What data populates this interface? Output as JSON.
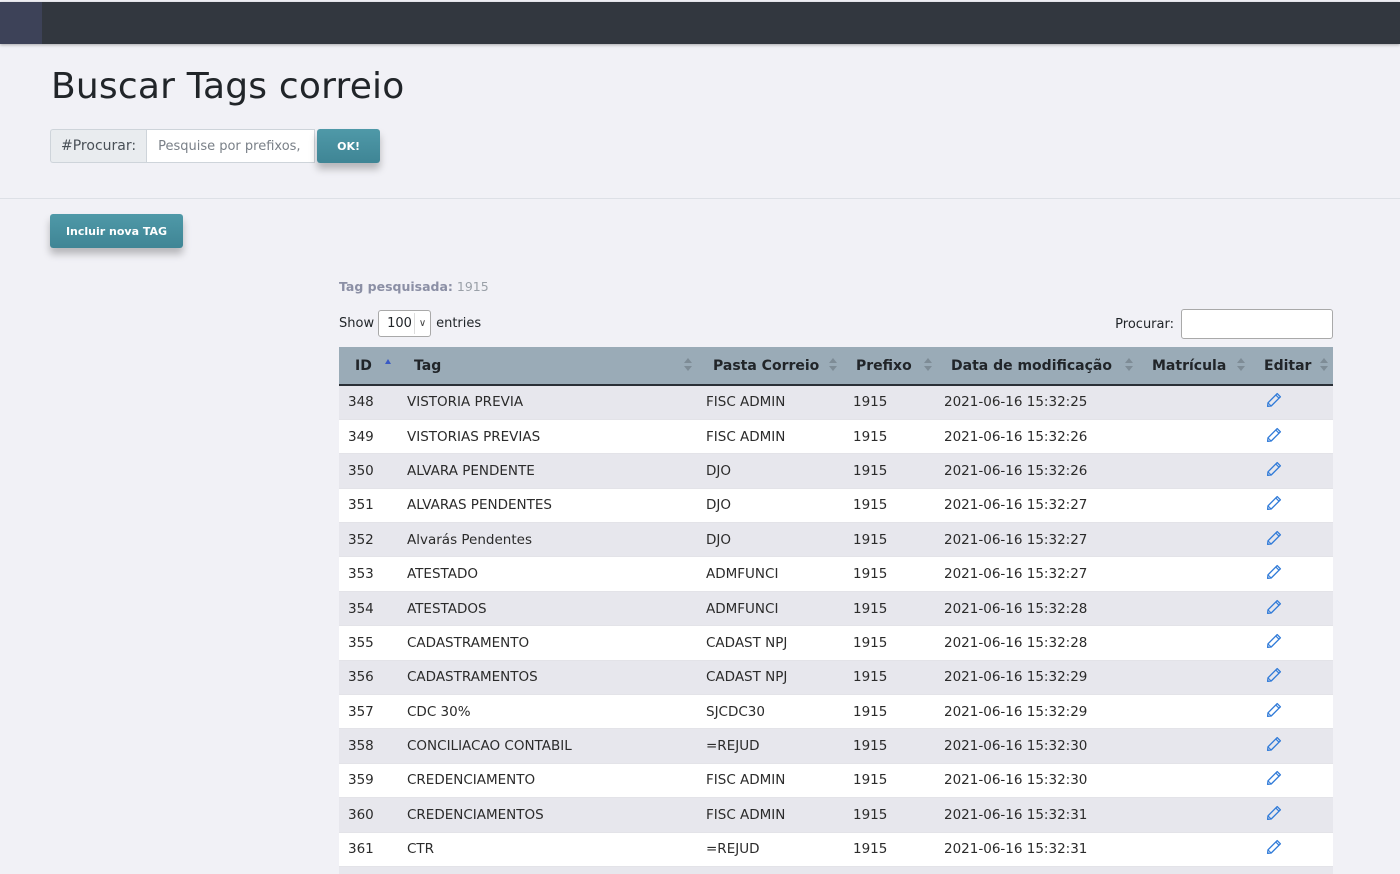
{
  "page": {
    "title": "Buscar Tags correio"
  },
  "search": {
    "prefix_label": "#Procurar:",
    "placeholder": "Pesquise por prefixos, tags...",
    "ok_label": "OK!"
  },
  "actions": {
    "new_tag_label": "Incluir nova TAG"
  },
  "result_info": {
    "label": "Tag pesquisada:",
    "value": "1915"
  },
  "table_controls": {
    "show_label": "Show",
    "entries_value": "100",
    "entries_label": "entries",
    "filter_label": "Procurar:"
  },
  "table": {
    "columns": [
      "ID",
      "Tag",
      "Pasta Correio",
      "Prefixo",
      "Data de modificação",
      "Matrícula",
      "Editar"
    ],
    "rows": [
      {
        "id": "348",
        "tag": "VISTORIA PREVIA",
        "pasta": "FISC ADMIN",
        "prefixo": "1915",
        "data": "2021-06-16 15:32:25",
        "matricula": ""
      },
      {
        "id": "349",
        "tag": "VISTORIAS PREVIAS",
        "pasta": "FISC ADMIN",
        "prefixo": "1915",
        "data": "2021-06-16 15:32:26",
        "matricula": ""
      },
      {
        "id": "350",
        "tag": "ALVARA PENDENTE",
        "pasta": "DJO",
        "prefixo": "1915",
        "data": "2021-06-16 15:32:26",
        "matricula": ""
      },
      {
        "id": "351",
        "tag": "ALVARAS PENDENTES",
        "pasta": "DJO",
        "prefixo": "1915",
        "data": "2021-06-16 15:32:27",
        "matricula": ""
      },
      {
        "id": "352",
        "tag": "Alvarás Pendentes",
        "pasta": "DJO",
        "prefixo": "1915",
        "data": "2021-06-16 15:32:27",
        "matricula": ""
      },
      {
        "id": "353",
        "tag": "ATESTADO",
        "pasta": "ADMFUNCI",
        "prefixo": "1915",
        "data": "2021-06-16 15:32:27",
        "matricula": ""
      },
      {
        "id": "354",
        "tag": "ATESTADOS",
        "pasta": "ADMFUNCI",
        "prefixo": "1915",
        "data": "2021-06-16 15:32:28",
        "matricula": ""
      },
      {
        "id": "355",
        "tag": "CADASTRAMENTO",
        "pasta": "CADAST NPJ",
        "prefixo": "1915",
        "data": "2021-06-16 15:32:28",
        "matricula": ""
      },
      {
        "id": "356",
        "tag": "CADASTRAMENTOS",
        "pasta": "CADAST NPJ",
        "prefixo": "1915",
        "data": "2021-06-16 15:32:29",
        "matricula": ""
      },
      {
        "id": "357",
        "tag": "CDC 30%",
        "pasta": "SJCDC30",
        "prefixo": "1915",
        "data": "2021-06-16 15:32:29",
        "matricula": ""
      },
      {
        "id": "358",
        "tag": "CONCILIACAO CONTABIL",
        "pasta": "=REJUD",
        "prefixo": "1915",
        "data": "2021-06-16 15:32:30",
        "matricula": ""
      },
      {
        "id": "359",
        "tag": "CREDENCIAMENTO",
        "pasta": "FISC ADMIN",
        "prefixo": "1915",
        "data": "2021-06-16 15:32:30",
        "matricula": ""
      },
      {
        "id": "360",
        "tag": "CREDENCIAMENTOS",
        "pasta": "FISC ADMIN",
        "prefixo": "1915",
        "data": "2021-06-16 15:32:31",
        "matricula": ""
      },
      {
        "id": "361",
        "tag": "CTR",
        "pasta": "=REJUD",
        "prefixo": "1915",
        "data": "2021-06-16 15:32:31",
        "matricula": ""
      },
      {
        "id": "",
        "tag": "",
        "pasta": "",
        "prefixo": "",
        "data": "",
        "matricula": ""
      }
    ]
  },
  "colors": {
    "topbar": "#32373f",
    "accent_button": "#4a93a3",
    "table_header": "#9aabb7",
    "edit_icon": "#2f7ad8"
  },
  "icons": {
    "edit": "pencil-icon",
    "sort": "sort-arrows-icon"
  }
}
